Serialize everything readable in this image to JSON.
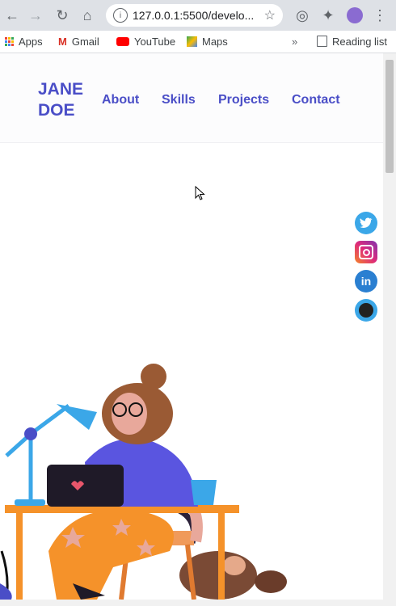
{
  "browser": {
    "url": "127.0.0.1:5500/develo...",
    "reading_list": "Reading list",
    "bookmarks": [
      "Apps",
      "Gmail",
      "YouTube",
      "Maps"
    ],
    "more": "»"
  },
  "site": {
    "brand_line1": "JANE",
    "brand_line2": "DOE",
    "nav": [
      "About",
      "Skills",
      "Projects",
      "Contact"
    ]
  },
  "social_icons": [
    "twitter-icon",
    "instagram-icon",
    "linkedin-icon",
    "github-icon"
  ],
  "colors": {
    "accent": "#4a4ec7",
    "illustration_purple": "#5a55e0",
    "illustration_orange": "#f5922a",
    "lamp_blue": "#3ba7e8"
  }
}
